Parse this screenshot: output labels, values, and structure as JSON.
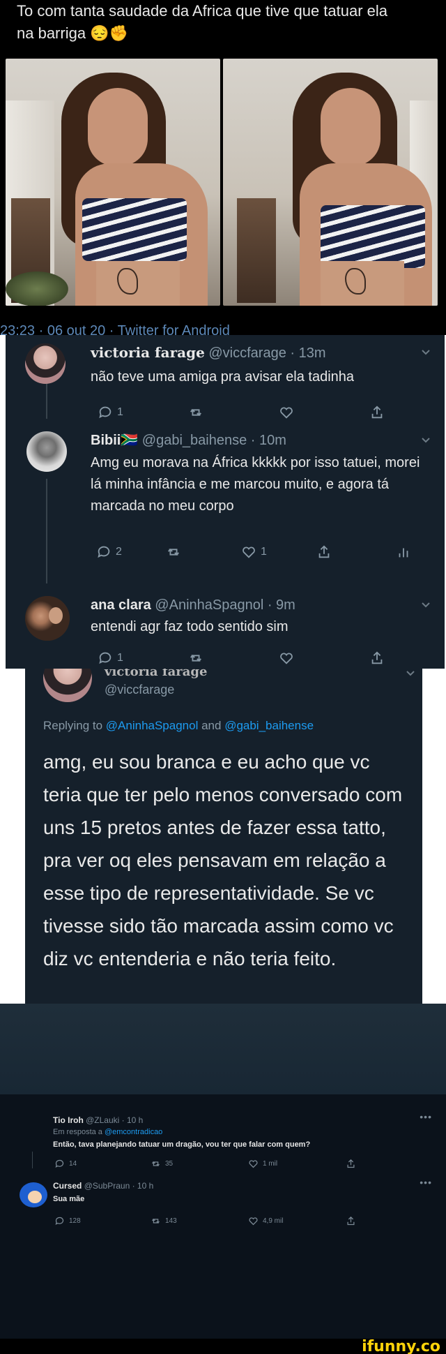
{
  "panel1": {
    "tweet_text": "To com tanta saudade da Africa que tive que tatuar ela na barriga 😔✊",
    "meta": "23:23 · 06 out 20 · Twitter for Android"
  },
  "panel2": {
    "tweets": [
      {
        "name": "victoria farage",
        "handle": "@viccfarage · 13m",
        "text": "não teve uma amiga pra avisar ela tadinha",
        "reply_count": "1",
        "retweet_count": "",
        "like_count": "",
        "avatar_icon": "masked-person-avatar"
      },
      {
        "name": "Bibii🇿🇦",
        "handle": "@gabi_baihense · 10m",
        "text": "Amg eu morava na África kkkkk por isso tatuei, morei lá minha infância e me marcou muito, e agora tá marcada no meu corpo",
        "reply_count": "2",
        "retweet_count": "",
        "like_count": "1",
        "avatar_icon": "grayscale-photo-avatar"
      },
      {
        "name": "ana clara",
        "handle": "@AninhaSpagnol · 9m",
        "text": "entendi agr faz todo sentido sim",
        "reply_count": "1",
        "retweet_count": "",
        "like_count": "",
        "avatar_icon": "two-girls-avatar"
      }
    ]
  },
  "panel3": {
    "name": "victoria farage",
    "handle": "@viccfarage",
    "replying_prefix": "Replying to ",
    "replying_user1": "@AninhaSpagnol",
    "replying_and": " and ",
    "replying_user2": "@gabi_baihense",
    "text": "amg, eu sou branca e eu acho que vc teria que ter pelo menos conversado com uns 15 pretos antes de fazer essa tatto, pra ver oq eles pensavam em relação a esse tipo de representatividade. Se vc tivesse sido tão marcada assim como vc diz vc entenderia e não teria feito."
  },
  "panel4": {
    "tweets": [
      {
        "name": "Tio Iroh",
        "handle": "@ZLauki · 10 h",
        "reply_prefix": "Em resposta a ",
        "reply_to": "@emcontradicao",
        "text": "Então, tava planejando tatuar um dragão, vou ter que falar com quem?",
        "replies": "14",
        "retweets": "35",
        "likes": "1 mil"
      },
      {
        "name": "Cursed",
        "handle": "@SubPraun · 10 h",
        "text": "Sua mãe",
        "replies": "128",
        "retweets": "143",
        "likes": "4,9 mil"
      }
    ]
  },
  "footer": {
    "brand": "ifunny.co"
  }
}
